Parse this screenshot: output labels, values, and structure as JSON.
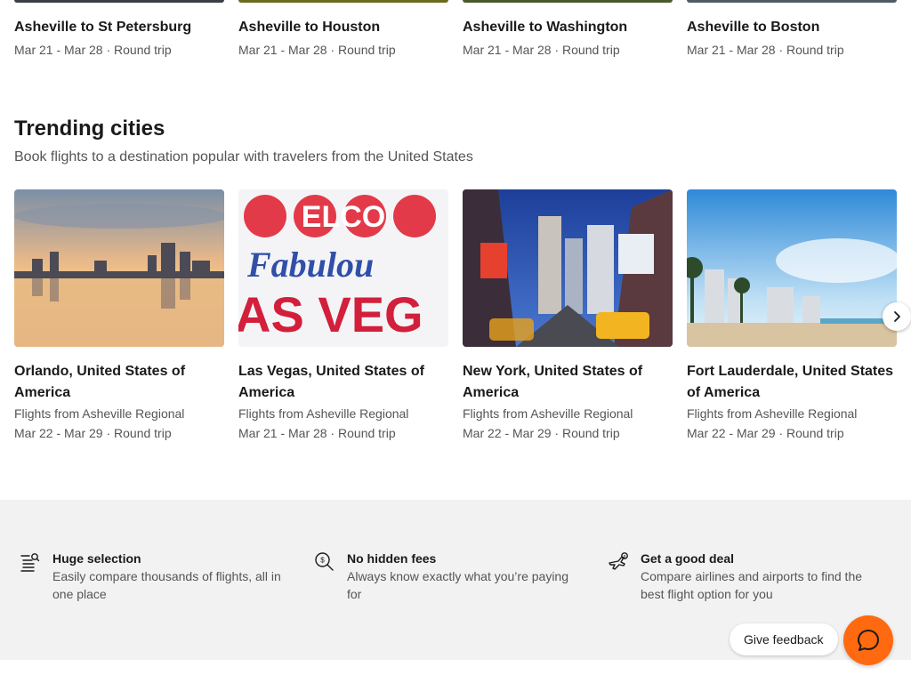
{
  "routes": [
    {
      "title": "Asheville to St Petersburg",
      "meta": "Mar 21 - Mar 28 · Round trip"
    },
    {
      "title": "Asheville to Houston",
      "meta": "Mar 21 - Mar 28 · Round trip"
    },
    {
      "title": "Asheville to Washington",
      "meta": "Mar 21 - Mar 28 · Round trip"
    },
    {
      "title": "Asheville to Boston",
      "meta": "Mar 21 - Mar 28 · Round trip"
    }
  ],
  "trending": {
    "title": "Trending cities",
    "subtitle": "Book flights to a destination popular with travelers from the United States",
    "cities": [
      {
        "name": "Orlando, United States of America",
        "from": "Flights from Asheville Regional",
        "dates": "Mar 22 - Mar 29 · Round trip"
      },
      {
        "name": "Las Vegas, United States of America",
        "from": "Flights from Asheville Regional",
        "dates": "Mar 21 - Mar 28 · Round trip",
        "sign_text": {
          "top": "ELCO",
          "middle": "Fabulou",
          "bottom": "AS VEG"
        }
      },
      {
        "name": "New York, United States of America",
        "from": "Flights from Asheville Regional",
        "dates": "Mar 22 - Mar 29 · Round trip"
      },
      {
        "name": "Fort Lauderdale, United States of America",
        "from": "Flights from Asheville Regional",
        "dates": "Mar 22 - Mar 29 · Round trip"
      }
    ]
  },
  "features": [
    {
      "icon": "list-search-icon",
      "title": "Huge selection",
      "desc": "Easily compare thousands of flights, all in one place"
    },
    {
      "icon": "price-magnifier-icon",
      "title": "No hidden fees",
      "desc": "Always know exactly what you’re paying for"
    },
    {
      "icon": "plane-deal-icon",
      "title": "Get a good deal",
      "desc": "Compare airlines and airports to find the best flight option for you"
    }
  ],
  "feedback": {
    "label": "Give feedback"
  },
  "colors": {
    "accent": "#ff690f",
    "band": "#f2f2f2"
  }
}
